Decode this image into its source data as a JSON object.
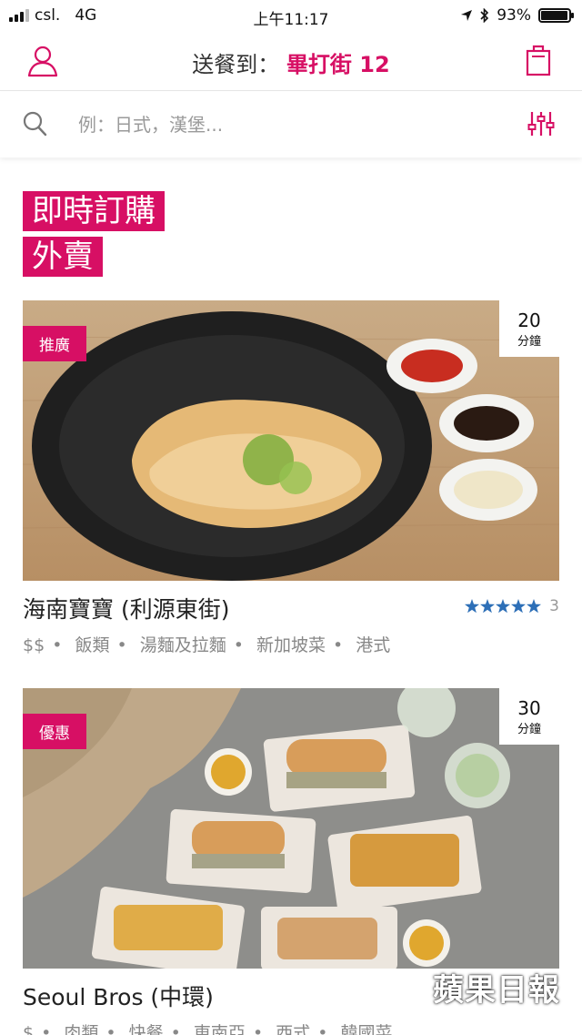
{
  "status_bar": {
    "carrier": "csl.",
    "network": "4G",
    "time": "上午11:17",
    "battery": "93%"
  },
  "header": {
    "deliver_label": "送餐到：",
    "address": "畢打街 12",
    "icons": [
      "user-icon",
      "bag-icon"
    ]
  },
  "search": {
    "placeholder": "例：日式，漢堡..."
  },
  "page_title": {
    "line1": "即時訂購",
    "line2": "外賣"
  },
  "colors": {
    "brand": "#d70f64",
    "star": "#2d6fb7"
  },
  "restaurants": [
    {
      "badge": "推廣",
      "eta_num": "20",
      "eta_unit": "分鐘",
      "name": "海南寶寶 (利源東街)",
      "rating_stars": 5,
      "rating_count": "3",
      "tags": [
        "$$",
        "飯類",
        "湯麵及拉麵",
        "新加坡菜",
        "港式"
      ]
    },
    {
      "badge": "優惠",
      "eta_num": "30",
      "eta_unit": "分鐘",
      "name": "Seoul Bros (中環)",
      "tags": [
        "$",
        "肉類",
        "快餐",
        "東南亞",
        "西式",
        "韓國菜"
      ]
    }
  ],
  "watermark": "蘋果日報"
}
